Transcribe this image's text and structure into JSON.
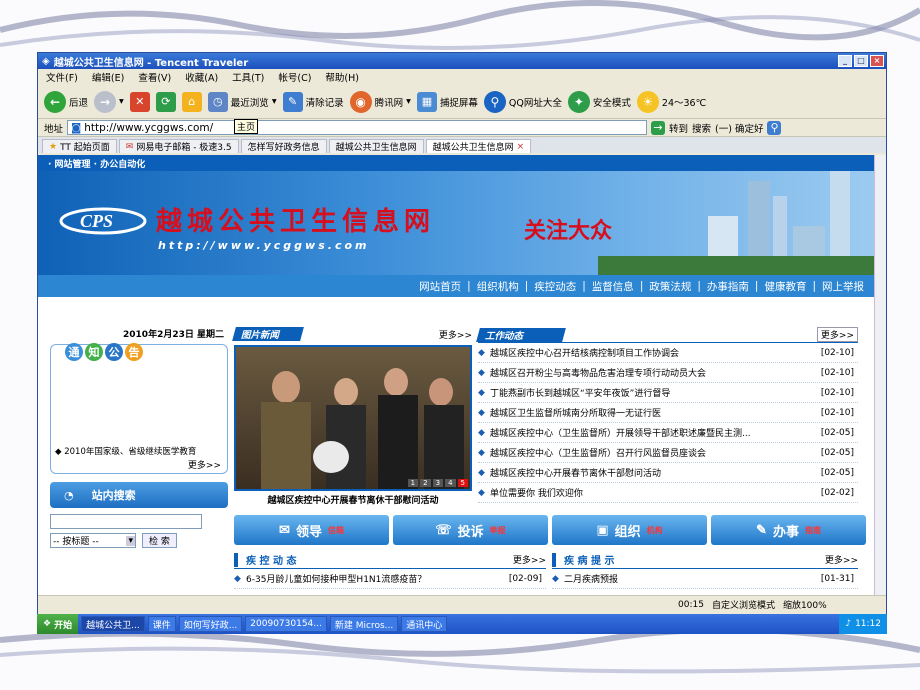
{
  "window": {
    "title": "越城公共卫生信息网 - Tencent Traveler"
  },
  "menu": [
    "文件(F)",
    "编辑(E)",
    "查看(V)",
    "收藏(A)",
    "工具(T)",
    "帐号(C)",
    "帮助(H)"
  ],
  "toolbar": {
    "back": "后退",
    "recent": "最近浏览",
    "clear": "清除记录",
    "tencent": "腾讯网",
    "capture": "捕捉屏幕",
    "qq_nav": "QQ网址大全",
    "safe_mode": "安全模式",
    "weather": "24～36℃",
    "tooltip": "主页"
  },
  "address": {
    "label": "地址",
    "url": "http://www.ycggws.com/",
    "go": "转到",
    "search_label": "搜索",
    "search_engine": "(一) 确定好"
  },
  "tabs": [
    "TT 起始页面",
    "网易电子邮箱 - 极速3.5",
    "怎样写好政务信息",
    "越城公共卫生信息网",
    "越城公共卫生信息网"
  ],
  "site": {
    "topnav": "· 网站管理 · 办公自动化",
    "title": "越城公共卫生信息网",
    "url": "http://www.ycggws.com",
    "slogan": "关注大众",
    "nav": [
      "网站首页",
      "组织机构",
      "疾控动态",
      "监督信息",
      "政策法规",
      "办事指南",
      "健康教育",
      "网上举报"
    ],
    "date": "2010年2月23日 星期二",
    "notice_title": "通知公告",
    "notice_item": "◆ 2010年国家级、省级继续医学教育",
    "more": "更多>>",
    "photo_news_title": "图片新闻",
    "photo_caption": "越城区疾控中心开展春节离休干部慰问活动",
    "photo_pages": [
      "1",
      "2",
      "3",
      "4",
      "5"
    ],
    "work_title": "工作动态",
    "work_news": [
      {
        "title": "越城区疾控中心召开结核病控制项目工作协调会",
        "date": "[02-10]"
      },
      {
        "title": "越城区召开粉尘与高毒物品危害治理专项行动动员大会",
        "date": "[02-10]"
      },
      {
        "title": "丁能燕副市长到越城区“平安年夜饭”进行督导",
        "date": "[02-10]"
      },
      {
        "title": "越城区卫生监督所城南分所取得一无证行医",
        "date": "[02-10]"
      },
      {
        "title": "越城区疾控中心（卫生监督所）开展领导干部述职述廉暨民主测...",
        "date": "[02-05]"
      },
      {
        "title": "越城区疾控中心（卫生监督所）召开行风监督员座谈会",
        "date": "[02-05]"
      },
      {
        "title": "越城区疾控中心开展春节离休干部慰问活动",
        "date": "[02-05]"
      },
      {
        "title": "单位需要你 我们欢迎你",
        "date": "[02-02]"
      }
    ],
    "search_title": "站内搜索",
    "search_select": "-- 按标题 --",
    "search_btn": "检 索",
    "buttons": [
      {
        "main": "领导",
        "sub": "信箱"
      },
      {
        "main": "投诉",
        "sub": "举报"
      },
      {
        "main": "组织",
        "sub": "机构"
      },
      {
        "main": "办事",
        "sub": "指南"
      }
    ],
    "disease_title": "疾 控 动 态",
    "disease_item": {
      "title": "6-35月龄儿童如何接种甲型H1N1流感疫苗？",
      "date": "[02-09]"
    },
    "hint_title": "疾 病 提 示",
    "hint_item": {
      "title": "二月疾病预报",
      "date": "[01-31]"
    }
  },
  "status": {
    "time": "00:15",
    "mode": "自定义浏览模式",
    "zoom": "缩放100%"
  },
  "taskbar": {
    "start": "开始",
    "tasks": [
      "越城公共卫...",
      "课件",
      "如何写好政...",
      "20090730154...",
      "新建 Micros...",
      "通讯中心"
    ],
    "clock": "11:12"
  },
  "colors": {
    "brand_blue": "#0b5fb8",
    "title_red": "#d60f1e"
  }
}
